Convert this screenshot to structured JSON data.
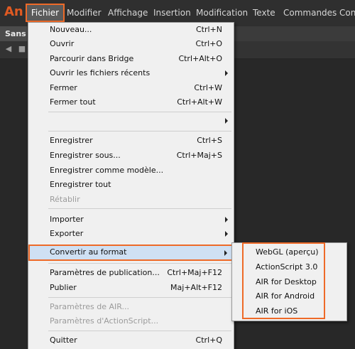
{
  "app": {
    "logo": "An"
  },
  "menubar": {
    "items": [
      "Fichier",
      "Modifier",
      "Affichage",
      "Insertion",
      "Modification",
      "Texte",
      "Commandes",
      "Cont"
    ]
  },
  "document": {
    "tab_title": "Sans nom"
  },
  "file_menu": {
    "items": [
      {
        "label": "Nouveau...",
        "shortcut": "Ctrl+N"
      },
      {
        "label": "Ouvrir",
        "shortcut": "Ctrl+O"
      },
      {
        "label": "Parcourir dans Bridge",
        "shortcut": "Ctrl+Alt+O"
      },
      {
        "label": "Ouvrir les fichiers récents",
        "shortcut": ""
      },
      {
        "label": "Fermer",
        "shortcut": "Ctrl+W"
      },
      {
        "label": "Fermer tout",
        "shortcut": "Ctrl+Alt+W"
      },
      {
        "label": "",
        "shortcut": ""
      },
      {
        "label": "Enregistrer",
        "shortcut": "Ctrl+S"
      },
      {
        "label": "Enregistrer sous...",
        "shortcut": "Ctrl+Maj+S"
      },
      {
        "label": "Enregistrer comme modèle...",
        "shortcut": ""
      },
      {
        "label": "Enregistrer tout",
        "shortcut": ""
      },
      {
        "label": "Rétablir",
        "shortcut": ""
      },
      {
        "label": "Importer",
        "shortcut": ""
      },
      {
        "label": "Exporter",
        "shortcut": ""
      },
      {
        "label": "Convertir au format",
        "shortcut": ""
      },
      {
        "label": "Paramètres de publication...",
        "shortcut": "Ctrl+Maj+F12"
      },
      {
        "label": "Publier",
        "shortcut": "Maj+Alt+F12"
      },
      {
        "label": "Paramètres de AIR...",
        "shortcut": ""
      },
      {
        "label": "Paramètres d'ActionScript...",
        "shortcut": ""
      },
      {
        "label": "Quitter",
        "shortcut": "Ctrl+Q"
      }
    ]
  },
  "convert_submenu": {
    "items": [
      "WebGL (aperçu)",
      "ActionScript 3.0",
      "AIR for Desktop",
      "AIR for Android",
      "AIR for iOS"
    ]
  },
  "colors": {
    "highlight_border": "#ee6a28",
    "highlight_fill": "#cfe0f3",
    "menu_bg": "#f0f0f0"
  }
}
